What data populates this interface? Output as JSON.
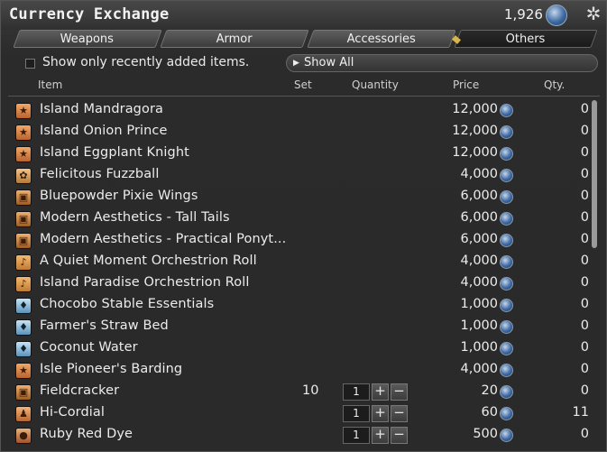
{
  "window": {
    "title": "Currency Exchange",
    "currency_amount": "1,926",
    "currency_icon": "blue-coin-icon",
    "settings_icon": "gear-icon"
  },
  "tabs": [
    {
      "label": "Weapons",
      "active": false
    },
    {
      "label": "Armor",
      "active": false
    },
    {
      "label": "Accessories",
      "active": false
    },
    {
      "label": "Others",
      "active": true
    }
  ],
  "filter": {
    "checkbox_label": "Show only recently added items.",
    "checked": false,
    "dropdown_value": "Show All"
  },
  "columns": {
    "item": "Item",
    "set": "Set",
    "quantity": "Quantity",
    "price": "Price",
    "qty": "Qty."
  },
  "items": [
    {
      "icon": "star",
      "name": "Island Mandragora",
      "set": "",
      "quantity": "",
      "price": "12,000",
      "owned": "0"
    },
    {
      "icon": "star",
      "name": "Island Onion Prince",
      "set": "",
      "quantity": "",
      "price": "12,000",
      "owned": "0"
    },
    {
      "icon": "star",
      "name": "Island Eggplant Knight",
      "set": "",
      "quantity": "",
      "price": "12,000",
      "owned": "0"
    },
    {
      "icon": "bag",
      "name": "Felicitous Fuzzball",
      "set": "",
      "quantity": "",
      "price": "4,000",
      "owned": "0"
    },
    {
      "icon": "box",
      "name": "Bluepowder Pixie Wings",
      "set": "",
      "quantity": "",
      "price": "6,000",
      "owned": "0"
    },
    {
      "icon": "box",
      "name": "Modern Aesthetics - Tall Tails",
      "set": "",
      "quantity": "",
      "price": "6,000",
      "owned": "0"
    },
    {
      "icon": "box",
      "name": "Modern Aesthetics - Practical Ponyt...",
      "set": "",
      "quantity": "",
      "price": "6,000",
      "owned": "0"
    },
    {
      "icon": "note",
      "name": "A Quiet Moment Orchestrion Roll",
      "set": "",
      "quantity": "",
      "price": "4,000",
      "owned": "0"
    },
    {
      "icon": "note",
      "name": "Island Paradise Orchestrion Roll",
      "set": "",
      "quantity": "",
      "price": "4,000",
      "owned": "0"
    },
    {
      "icon": "blue",
      "name": "Chocobo Stable Essentials",
      "set": "",
      "quantity": "",
      "price": "1,000",
      "owned": "0"
    },
    {
      "icon": "blue",
      "name": "Farmer's Straw Bed",
      "set": "",
      "quantity": "",
      "price": "1,000",
      "owned": "0"
    },
    {
      "icon": "blue",
      "name": "Coconut Water",
      "set": "",
      "quantity": "",
      "price": "1,000",
      "owned": "0"
    },
    {
      "icon": "star",
      "name": "Isle Pioneer's Barding",
      "set": "",
      "quantity": "",
      "price": "4,000",
      "owned": "0"
    },
    {
      "icon": "box",
      "name": "Fieldcracker",
      "set": "10",
      "quantity": "1",
      "price": "20",
      "owned": "0"
    },
    {
      "icon": "potion",
      "name": "Hi-Cordial",
      "set": "",
      "quantity": "1",
      "price": "60",
      "owned": "11"
    },
    {
      "icon": "dye",
      "name": "Ruby Red Dye",
      "set": "",
      "quantity": "1",
      "price": "500",
      "owned": "0"
    }
  ],
  "stepper": {
    "plus": "+",
    "minus": "−"
  }
}
